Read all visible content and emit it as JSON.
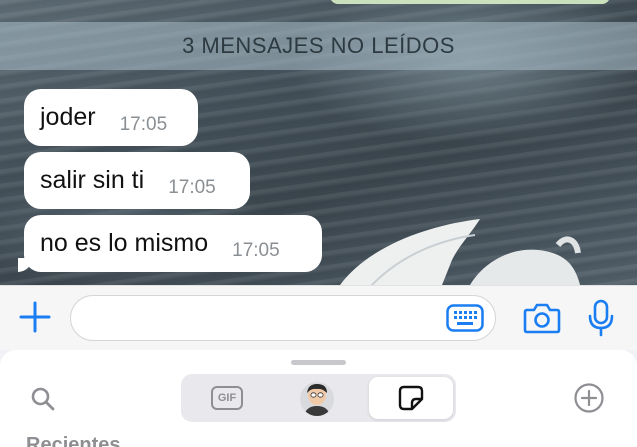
{
  "chat": {
    "unread_banner": "3 MENSAJES NO LEÍDOS",
    "messages": [
      {
        "text": "joder",
        "time": "17:05"
      },
      {
        "text": "salir sin ti",
        "time": "17:05"
      },
      {
        "text": "no es lo mismo",
        "time": "17:05"
      }
    ]
  },
  "composer": {
    "input_value": "",
    "icons": [
      "plus-icon",
      "keyboard-icon",
      "camera-icon",
      "microphone-icon"
    ]
  },
  "sticker_panel": {
    "tabs": [
      {
        "label": "GIF",
        "selected": false
      },
      {
        "icon": "avatar-icon",
        "selected": false
      },
      {
        "icon": "sticker-icon",
        "selected": true
      }
    ],
    "section_label": "Recientes"
  },
  "colors": {
    "accent": "#1a7ef2",
    "bubble": "#ffffff",
    "time": "#8a8f94"
  }
}
